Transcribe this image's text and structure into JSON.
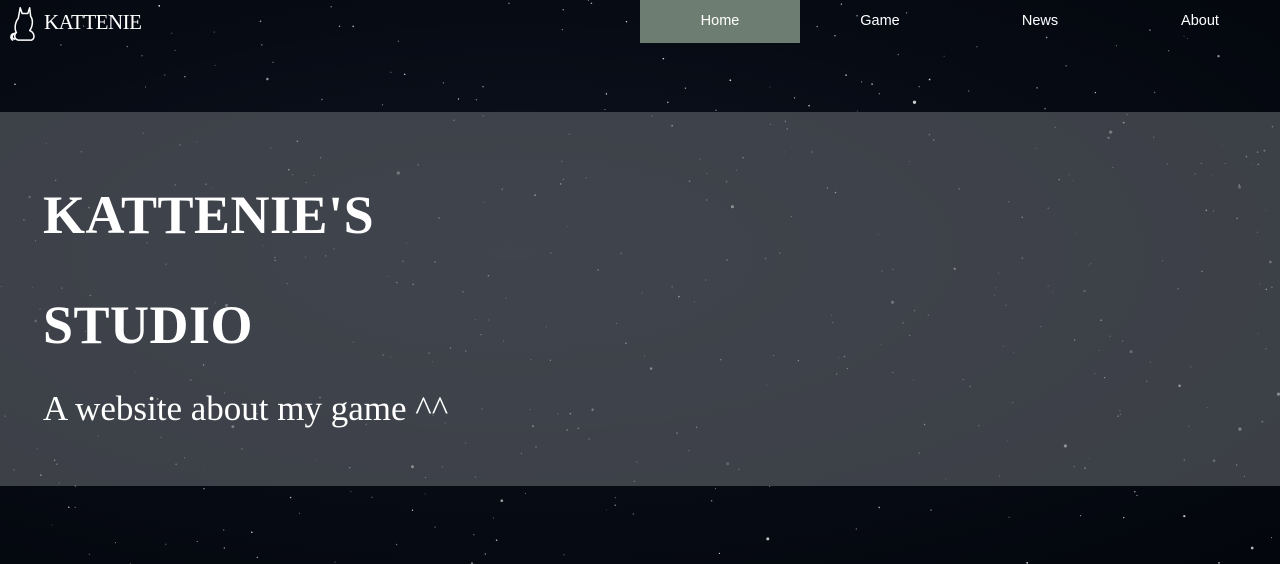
{
  "brand": {
    "logo_icon": "cat-icon",
    "name": "KATTENIE"
  },
  "nav": {
    "items": [
      {
        "label": "Home",
        "active": true
      },
      {
        "label": "Game",
        "active": false
      },
      {
        "label": "News",
        "active": false
      },
      {
        "label": "About",
        "active": false
      }
    ]
  },
  "hero": {
    "title_line1": "KATTENIE'S",
    "title_line2": "STUDIO",
    "subtitle": "A website about my game ^^"
  },
  "colors": {
    "active_nav": "#6e7d71",
    "background": "#050912",
    "hero_band": "#5f6269",
    "text": "#ffffff"
  }
}
